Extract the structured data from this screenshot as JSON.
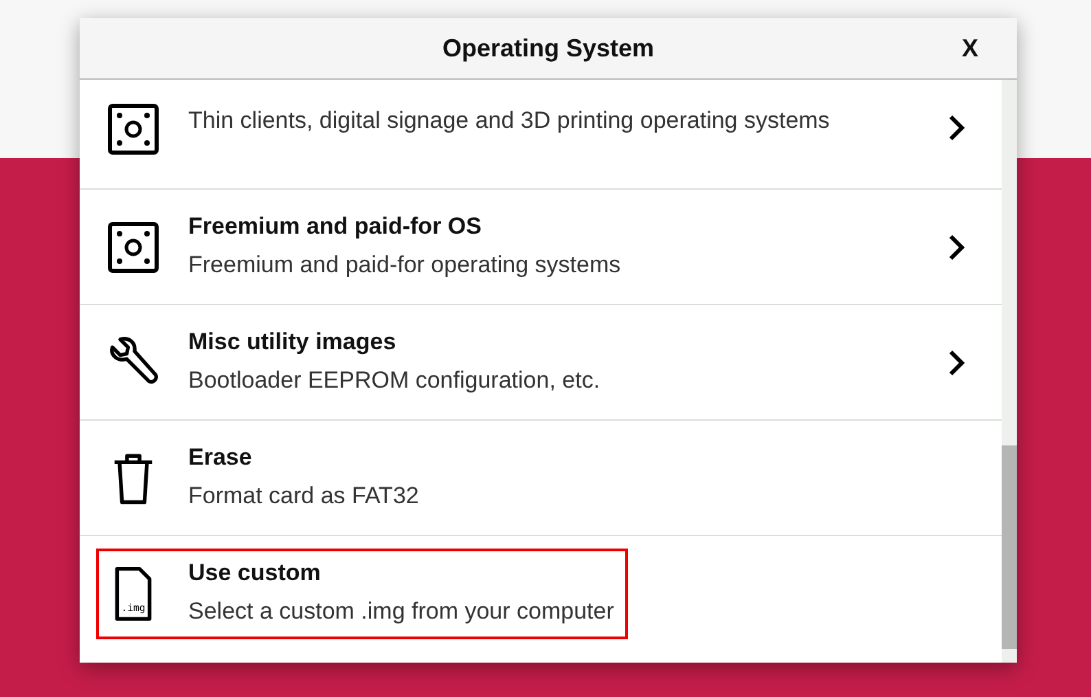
{
  "dialog": {
    "title": "Operating System",
    "close_label": "X"
  },
  "items": [
    {
      "kind": "board",
      "description": "Thin clients, digital signage and 3D printing operating systems",
      "has_submenu": true,
      "highlighted": false
    },
    {
      "kind": "board",
      "title": "Freemium and paid-for OS",
      "description": "Freemium and paid-for operating systems",
      "has_submenu": true,
      "highlighted": false
    },
    {
      "kind": "wrench",
      "title": "Misc utility images",
      "description": "Bootloader EEPROM configuration, etc.",
      "has_submenu": true,
      "highlighted": false
    },
    {
      "kind": "trash",
      "title": "Erase",
      "description": "Format card as FAT32",
      "has_submenu": false,
      "highlighted": false
    },
    {
      "kind": "file",
      "icon_text": ".img",
      "title": "Use custom",
      "description": "Select a custom .img from your computer",
      "has_submenu": false,
      "highlighted": true
    }
  ]
}
